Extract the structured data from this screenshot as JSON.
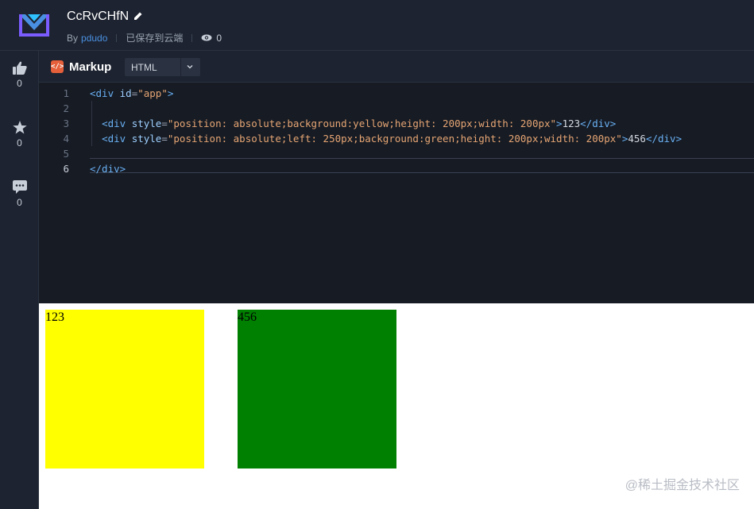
{
  "header": {
    "title": "CcRvCHfN",
    "by_label": "By",
    "author": "pdudo",
    "save_status": "已保存到云端",
    "views": "0"
  },
  "rail": {
    "likes": "0",
    "stars": "0",
    "comments": "0"
  },
  "editor": {
    "panel_label": "Markup",
    "language": "HTML",
    "line_numbers": [
      "1",
      "2",
      "3",
      "4",
      "5",
      "6"
    ],
    "lines": [
      [
        {
          "t": "tag",
          "v": "<div "
        },
        {
          "t": "attr",
          "v": "id"
        },
        {
          "t": "punc",
          "v": "="
        },
        {
          "t": "str",
          "v": "\"app\""
        },
        {
          "t": "tag",
          "v": ">"
        }
      ],
      [],
      [
        {
          "t": "plain",
          "v": "  "
        },
        {
          "t": "tag",
          "v": "<div "
        },
        {
          "t": "attr",
          "v": "style"
        },
        {
          "t": "punc",
          "v": "="
        },
        {
          "t": "str",
          "v": "\"position: absolute;background:yellow;height: 200px;width: 200px\""
        },
        {
          "t": "tag",
          "v": ">"
        },
        {
          "t": "plain",
          "v": "123"
        },
        {
          "t": "tag",
          "v": "</div>"
        }
      ],
      [
        {
          "t": "plain",
          "v": "  "
        },
        {
          "t": "tag",
          "v": "<div "
        },
        {
          "t": "attr",
          "v": "style"
        },
        {
          "t": "punc",
          "v": "="
        },
        {
          "t": "str",
          "v": "\"position: absolute;left: 250px;background:green;height: 200px;width: 200px\""
        },
        {
          "t": "tag",
          "v": ">"
        },
        {
          "t": "plain",
          "v": "456"
        },
        {
          "t": "tag",
          "v": "</div>"
        }
      ],
      [],
      [
        {
          "t": "tag",
          "v": "</div>"
        }
      ]
    ]
  },
  "preview": {
    "box1_text": "123",
    "box2_text": "456",
    "watermark": "@稀土掘金技术社区"
  },
  "colors": {
    "accent": "#4a90e2",
    "markup_badge": "#e45f3a",
    "box1": "#ffff00",
    "box2": "#008000"
  }
}
